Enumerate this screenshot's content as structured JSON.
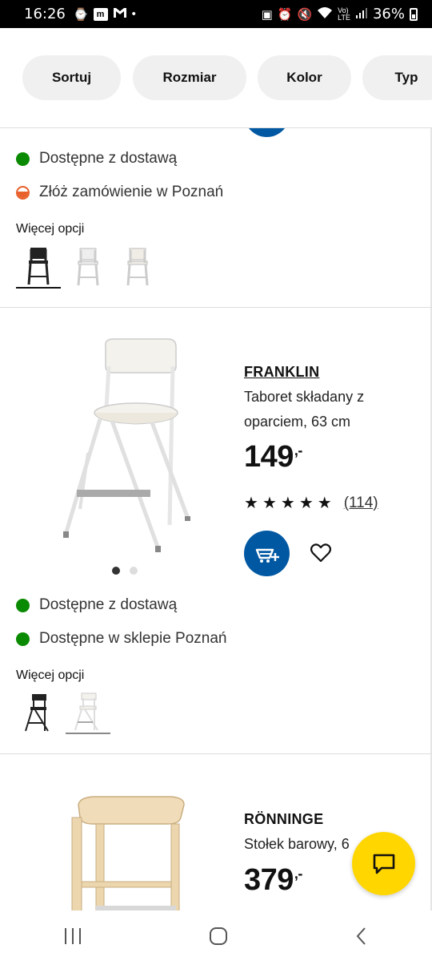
{
  "status_bar": {
    "time": "16:26",
    "battery": "36%",
    "left_icons": [
      "watch-icon",
      "m-app-icon",
      "gmail-icon",
      "dot-icon"
    ],
    "right_icons": [
      "nfc-icon",
      "alarm-icon",
      "mute-icon",
      "wifi-icon",
      "volte-icon",
      "signal-icon",
      "battery-icon"
    ]
  },
  "filters": {
    "chips": [
      "Sortuj",
      "Rozmiar",
      "Kolor",
      "Typ"
    ]
  },
  "product_prev": {
    "availability": [
      {
        "text": "Dostępne z dostawą",
        "status": "green"
      },
      {
        "text": "Złóż zamówienie w Poznań",
        "status": "orange"
      }
    ],
    "more_options_label": "Więcej opcji",
    "options": [
      "black-stool",
      "white-stool",
      "white-stool-2"
    ]
  },
  "product_franklin": {
    "name": "FRANKLIN",
    "description": "Taboret składany z oparciem, 63 cm",
    "price": "149",
    "price_suffix": ",-",
    "rating": 5,
    "reviews": "(114)",
    "availability": [
      {
        "text": "Dostępne z dostawą",
        "status": "green"
      },
      {
        "text": "Dostępne w sklepie Poznań",
        "status": "green"
      }
    ],
    "more_options_label": "Więcej opcji",
    "image_count": 2,
    "active_image": 0
  },
  "product_ronninge": {
    "name": "RÖNNINGE",
    "description": "Stołek barowy, 6",
    "price": "379",
    "price_suffix": ",-"
  },
  "colors": {
    "ikea_blue": "#0058a3",
    "chat_yellow": "#ffd600",
    "green": "#0a8a00",
    "orange": "#e8612c"
  }
}
